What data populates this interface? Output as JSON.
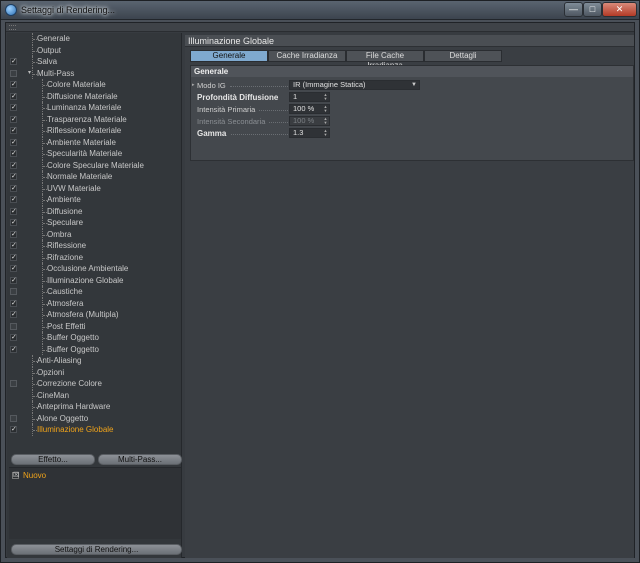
{
  "window": {
    "title": "Settaggi di Rendering...",
    "buttons": {
      "minimize": "—",
      "maximize": "□",
      "close": "✕"
    }
  },
  "tree": [
    {
      "label": "Generale",
      "checkbox": "none",
      "indent": 0,
      "active": false
    },
    {
      "label": "Output",
      "checkbox": "none",
      "indent": 0,
      "active": false
    },
    {
      "label": "Salva",
      "checkbox": "checked",
      "indent": 0,
      "active": false
    },
    {
      "label": "Multi-Pass",
      "checkbox": "unchecked",
      "indent": 0,
      "active": false,
      "expander": "▾"
    },
    {
      "label": "Colore Materiale",
      "checkbox": "checked",
      "indent": 1,
      "active": false
    },
    {
      "label": "Diffusione Materiale",
      "checkbox": "checked",
      "indent": 1,
      "active": false
    },
    {
      "label": "Luminanza Materiale",
      "checkbox": "checked",
      "indent": 1,
      "active": false
    },
    {
      "label": "Trasparenza Materiale",
      "checkbox": "checked",
      "indent": 1,
      "active": false
    },
    {
      "label": "Riflessione Materiale",
      "checkbox": "checked",
      "indent": 1,
      "active": false
    },
    {
      "label": "Ambiente Materiale",
      "checkbox": "checked",
      "indent": 1,
      "active": false
    },
    {
      "label": "Specularità Materiale",
      "checkbox": "checked",
      "indent": 1,
      "active": false
    },
    {
      "label": "Colore Speculare Materiale",
      "checkbox": "checked",
      "indent": 1,
      "active": false
    },
    {
      "label": "Normale Materiale",
      "checkbox": "checked",
      "indent": 1,
      "active": false
    },
    {
      "label": "UVW Materiale",
      "checkbox": "checked",
      "indent": 1,
      "active": false
    },
    {
      "label": "Ambiente",
      "checkbox": "checked",
      "indent": 1,
      "active": false
    },
    {
      "label": "Diffusione",
      "checkbox": "checked",
      "indent": 1,
      "active": false
    },
    {
      "label": "Speculare",
      "checkbox": "checked",
      "indent": 1,
      "active": false
    },
    {
      "label": "Ombra",
      "checkbox": "checked",
      "indent": 1,
      "active": false
    },
    {
      "label": "Riflessione",
      "checkbox": "checked",
      "indent": 1,
      "active": false
    },
    {
      "label": "Rifrazione",
      "checkbox": "checked",
      "indent": 1,
      "active": false
    },
    {
      "label": "Occlusione Ambientale",
      "checkbox": "checked",
      "indent": 1,
      "active": false
    },
    {
      "label": "Illuminazione Globale",
      "checkbox": "checked",
      "indent": 1,
      "active": false
    },
    {
      "label": "Caustiche",
      "checkbox": "unchecked",
      "indent": 1,
      "active": false
    },
    {
      "label": "Atmosfera",
      "checkbox": "checked",
      "indent": 1,
      "active": false
    },
    {
      "label": "Atmosfera (Multipla)",
      "checkbox": "checked",
      "indent": 1,
      "active": false
    },
    {
      "label": "Post Effetti",
      "checkbox": "unchecked",
      "indent": 1,
      "active": false
    },
    {
      "label": "Buffer Oggetto",
      "checkbox": "checked",
      "indent": 1,
      "active": false
    },
    {
      "label": "Buffer Oggetto",
      "checkbox": "checked",
      "indent": 1,
      "active": false
    },
    {
      "label": "Anti-Aliasing",
      "checkbox": "none",
      "indent": 0,
      "active": false
    },
    {
      "label": "Opzioni",
      "checkbox": "none",
      "indent": 0,
      "active": false
    },
    {
      "label": "Correzione Colore",
      "checkbox": "unchecked",
      "indent": 0,
      "active": false
    },
    {
      "label": "CineMan",
      "checkbox": "none",
      "indent": 0,
      "active": false
    },
    {
      "label": "Anteprima Hardware",
      "checkbox": "none",
      "indent": 0,
      "active": false
    },
    {
      "label": "Alone Oggetto",
      "checkbox": "unchecked",
      "indent": 0,
      "active": false
    },
    {
      "label": "Illuminazione Globale",
      "checkbox": "checked",
      "indent": 0,
      "active": true
    }
  ],
  "left_buttons": {
    "effetto": "Effetto...",
    "multipass": "Multi-Pass...",
    "settaggi": "Settaggi di Rendering..."
  },
  "preset": {
    "checkbox": "☒",
    "label": "Nuovo"
  },
  "panel": {
    "title": "Illuminazione Globale",
    "tabs": [
      "Generale",
      "Cache Irradianza",
      "File Cache Irradianza",
      "Dettagli"
    ],
    "active_tab": 0,
    "group_title": "Generale",
    "params": {
      "modo_ig": {
        "label": "Modo IG",
        "value": "IR (Immagine Statica)"
      },
      "profondita": {
        "label": "Profondità Diffusione",
        "value": "1"
      },
      "intensita_primaria": {
        "label": "Intensità Primaria",
        "value": "100 %"
      },
      "intensita_secondaria": {
        "label": "Intensità Secondaria",
        "value": "100 %"
      },
      "gamma": {
        "label": "Gamma",
        "value": "1.3"
      }
    }
  },
  "colors": {
    "accent_orange": "#f0a31a",
    "active_tab": "#7fa9cf"
  }
}
